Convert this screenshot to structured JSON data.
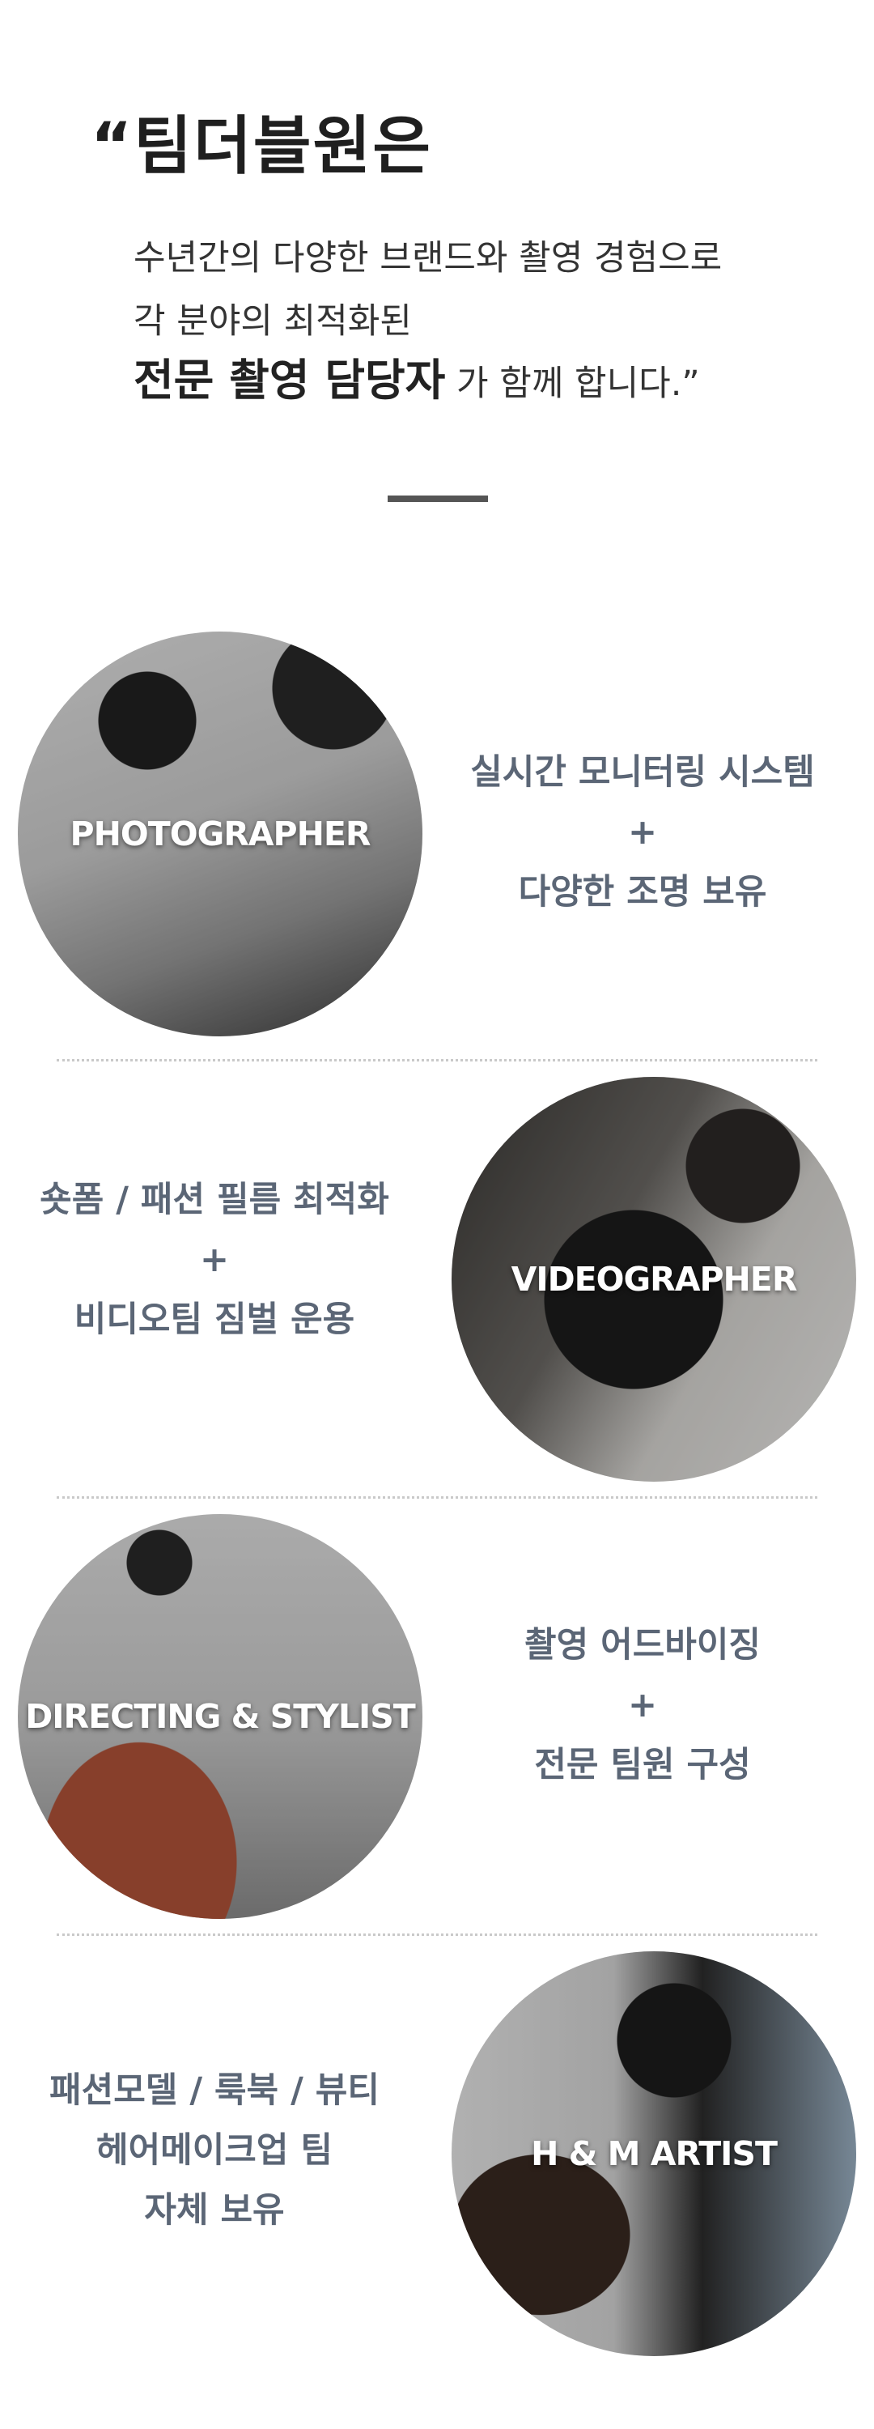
{
  "intro": {
    "headline": "“팀더블원은",
    "line1": "수년간의 다양한 브랜드와 촬영 경험으로",
    "line2": "각 분야의 최적화된",
    "line3_strong": "전문 촬영 담당자",
    "line3_rest": " 가 함께 합니다.”"
  },
  "sections": [
    {
      "role": "PHOTOGRAPHER",
      "desc": [
        "실시간 모니터링 시스템",
        "+",
        "다양한 조명 보유"
      ]
    },
    {
      "role": "VIDEOGRAPHER",
      "desc": [
        "숏폼 / 패션 필름 최적화",
        "+",
        "비디오팀 짐벌 운용"
      ]
    },
    {
      "role": "DIRECTING & STYLIST",
      "desc": [
        "촬영 어드바이징",
        "+",
        "전문 팀원 구성"
      ]
    },
    {
      "role": "H & M  ARTIST",
      "desc": [
        "패션모델 / 룩북 / 뷰티",
        "헤어메이크업 팀",
        "자체 보유"
      ]
    }
  ],
  "colors": {
    "desc_text": "#5b6676",
    "rule": "#555555",
    "separator": "#c9c9c9"
  }
}
